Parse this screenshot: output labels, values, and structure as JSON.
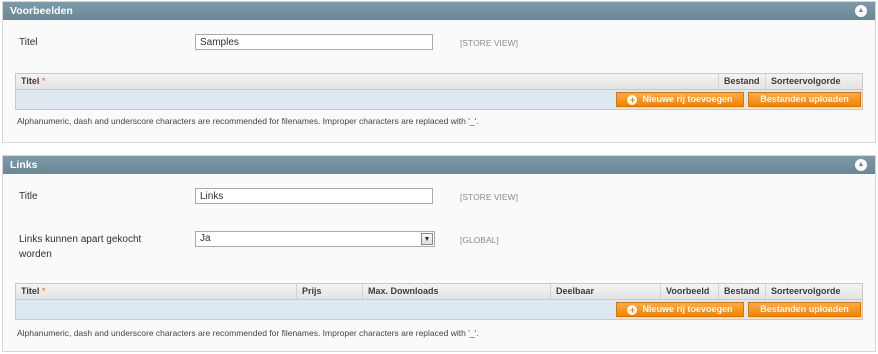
{
  "samples": {
    "header": "Voorbeelden",
    "title_label": "Titel",
    "title_value": "Samples",
    "title_scope": "[STORE VIEW]",
    "grid_columns": [
      "Titel",
      "Bestand",
      "Sorteervolgorde"
    ],
    "required_mark": "*",
    "add_row_label": "Nieuwe rij toevoegen",
    "upload_label": "Bestanden uploaden",
    "note": "Alphanumeric, dash and underscore characters are recommended for filenames. Improper characters are replaced with '_'."
  },
  "links": {
    "header": "Links",
    "title_label": "Title",
    "title_value": "Links",
    "title_scope": "[STORE VIEW]",
    "purchase_label": "Links kunnen apart gekocht worden",
    "purchase_value": "Ja",
    "purchase_scope": "[GLOBAL]",
    "grid_columns": [
      "Titel",
      "Prijs",
      "Max. Downloads",
      "Deelbaar",
      "Voorbeeld",
      "Bestand",
      "Sorteervolgorde"
    ],
    "required_mark": "*",
    "add_row_label": "Nieuwe rij toevoegen",
    "upload_label": "Bestanden uploaden",
    "note": "Alphanumeric, dash and underscore characters are recommended for filenames. Improper characters are replaced with '_'."
  },
  "icons": {
    "collapse": "collapse-up-icon",
    "add": "plus-circle-icon",
    "dropdown": "dropdown-arrow-icon"
  },
  "colors": {
    "header_bg": "#6a8795",
    "button_bg": "#f18200",
    "grid_body_bg": "#dde8f1"
  }
}
